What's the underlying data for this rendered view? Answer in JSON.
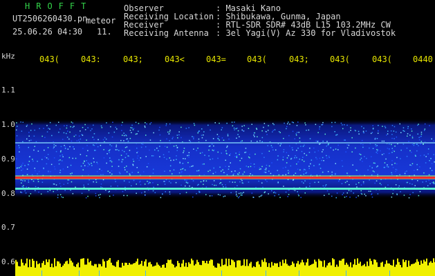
{
  "header": {
    "logo": "HROFFT",
    "filename": "UT2506260430.pn",
    "suffix": "meteor",
    "datetime": "25.06.26 04:30",
    "count": "11.",
    "observer_label": "Observer",
    "observer_value": ": Masaki Kano",
    "location_label": "Receiving Location",
    "location_value": ": Shibukawa, Gunma, Japan",
    "receiver_label": "Receiver",
    "receiver_value": ": RTL-SDR SDR# 43dB L15 103.2MHz CW",
    "antenna_label": "Receiving Antenna",
    "antenna_value": ": 3el Yagi(V) Az 330 for Vladivostok"
  },
  "time_axis": {
    "ticks": [
      "043(",
      "043:",
      "043;",
      "043<",
      "043=",
      "043(",
      "043;",
      "043(",
      "043(",
      "0440"
    ]
  },
  "freq_axis": {
    "unit": "kHz",
    "ticks": [
      "1.1",
      "1.0",
      "0.9",
      "0.8",
      "0.7",
      "0.6"
    ]
  },
  "colors": {
    "background": "#000000",
    "noise_blue": "#1530c8",
    "signal_red": "#ff2a2a",
    "signal_cyan": "#5cf0d2",
    "signal_green": "#b8ff60",
    "histogram": "#f0f000",
    "label_text": "#d8d8d8",
    "logo": "#33d44a"
  }
}
